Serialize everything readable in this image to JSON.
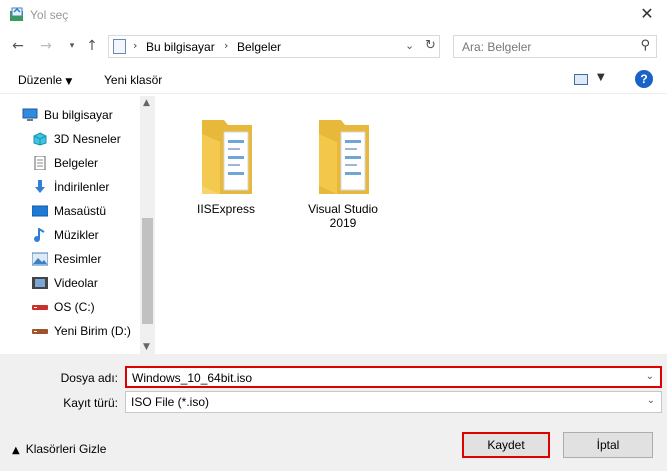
{
  "window": {
    "title": "Yol seç",
    "close_glyph": "✕"
  },
  "nav": {
    "back_icon": "arrow-left-icon",
    "forward_icon": "arrow-right-icon",
    "recent_icon": "chevron-down-icon",
    "up_icon": "arrow-up-icon",
    "breadcrumb": [
      "Bu bilgisayar",
      "Belgeler"
    ],
    "search_placeholder": "Ara: Belgeler"
  },
  "toolbar": {
    "organize_label": "Düzenle",
    "new_folder_label": "Yeni klasör",
    "help_label": "?"
  },
  "sidebar": {
    "items": [
      {
        "label": "Bu bilgisayar",
        "icon": "computer-icon"
      },
      {
        "label": "3D Nesneler",
        "icon": "cube-3d-icon"
      },
      {
        "label": "Belgeler",
        "icon": "document-icon"
      },
      {
        "label": "İndirilenler",
        "icon": "download-icon"
      },
      {
        "label": "Masaüstü",
        "icon": "desktop-icon"
      },
      {
        "label": "Müzikler",
        "icon": "music-icon"
      },
      {
        "label": "Resimler",
        "icon": "pictures-icon"
      },
      {
        "label": "Videolar",
        "icon": "video-icon"
      },
      {
        "label": "OS (C:)",
        "icon": "drive-icon"
      },
      {
        "label": "Yeni Birim (D:)",
        "icon": "drive-icon"
      }
    ]
  },
  "files": [
    {
      "name": "IISExpress",
      "icon": "folder-icon"
    },
    {
      "name": "Visual Studio 2019",
      "icon": "folder-icon"
    }
  ],
  "form": {
    "filename_label": "Dosya adı:",
    "filename_value": "Windows_10_64bit.iso",
    "filetype_label": "Kayıt türü:",
    "filetype_value": "ISO File (*.iso)"
  },
  "footer": {
    "hide_folders_label": "Klasörleri Gizle",
    "save_label": "Kaydet",
    "cancel_label": "İptal"
  },
  "colors": {
    "highlight": "#e00000",
    "help_blue": "#1b62c6",
    "folder": "#f3c94d"
  }
}
